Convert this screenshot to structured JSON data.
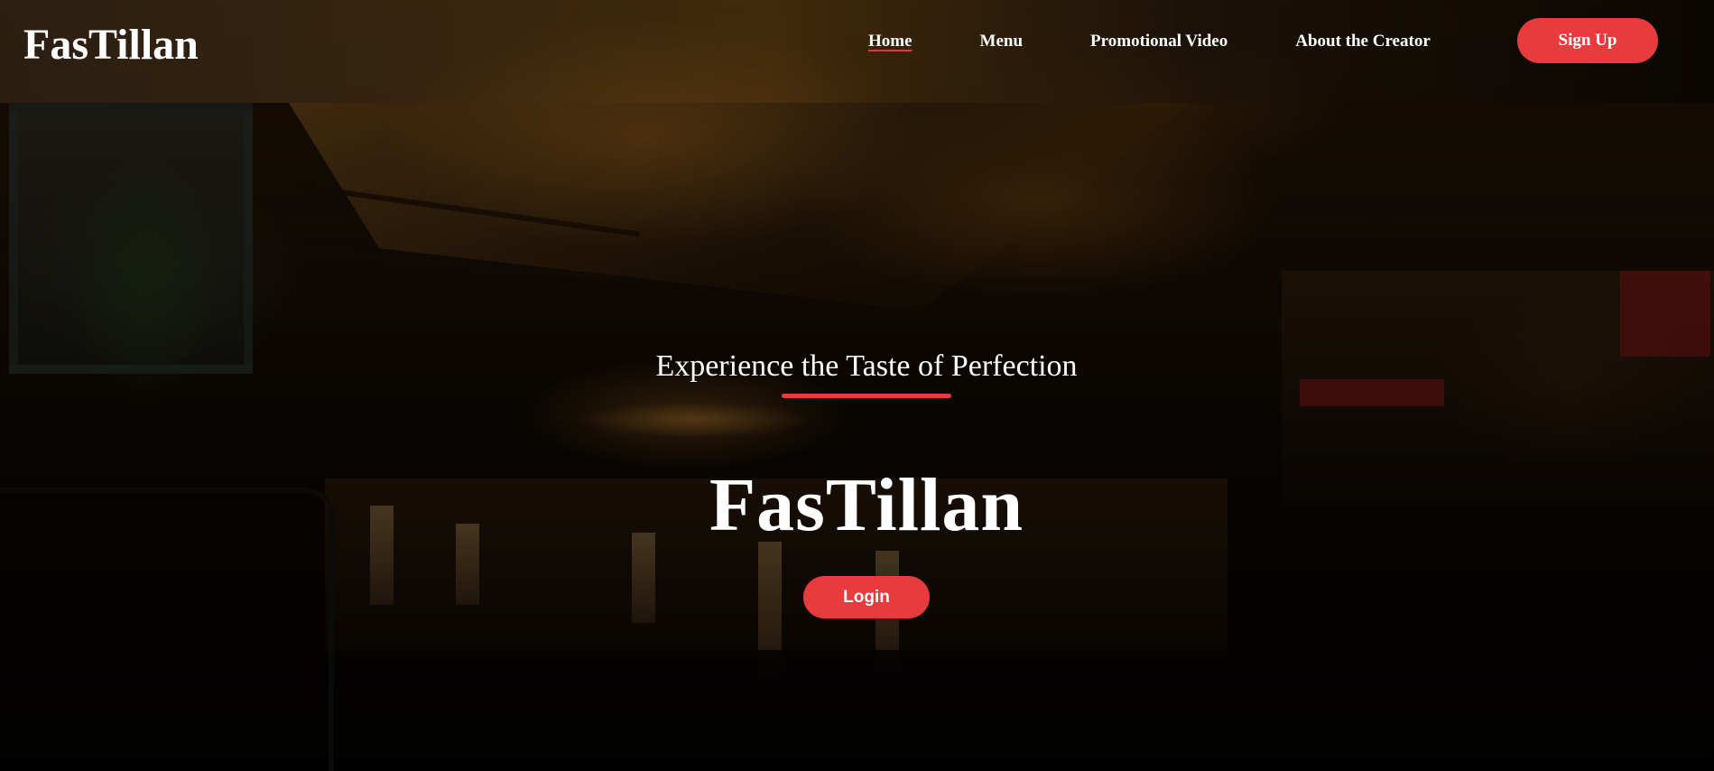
{
  "header": {
    "logo": "FasTillan",
    "nav": [
      {
        "label": "Home",
        "active": true
      },
      {
        "label": "Menu",
        "active": false
      },
      {
        "label": "Promotional Video",
        "active": false
      },
      {
        "label": "About the Creator",
        "active": false
      }
    ],
    "signup_label": "Sign Up"
  },
  "hero": {
    "tagline": "Experience the Taste of Perfection",
    "title": "FasTillan",
    "login_label": "Login"
  },
  "colors": {
    "accent": "#e73b3e",
    "text": "#ffffff"
  }
}
